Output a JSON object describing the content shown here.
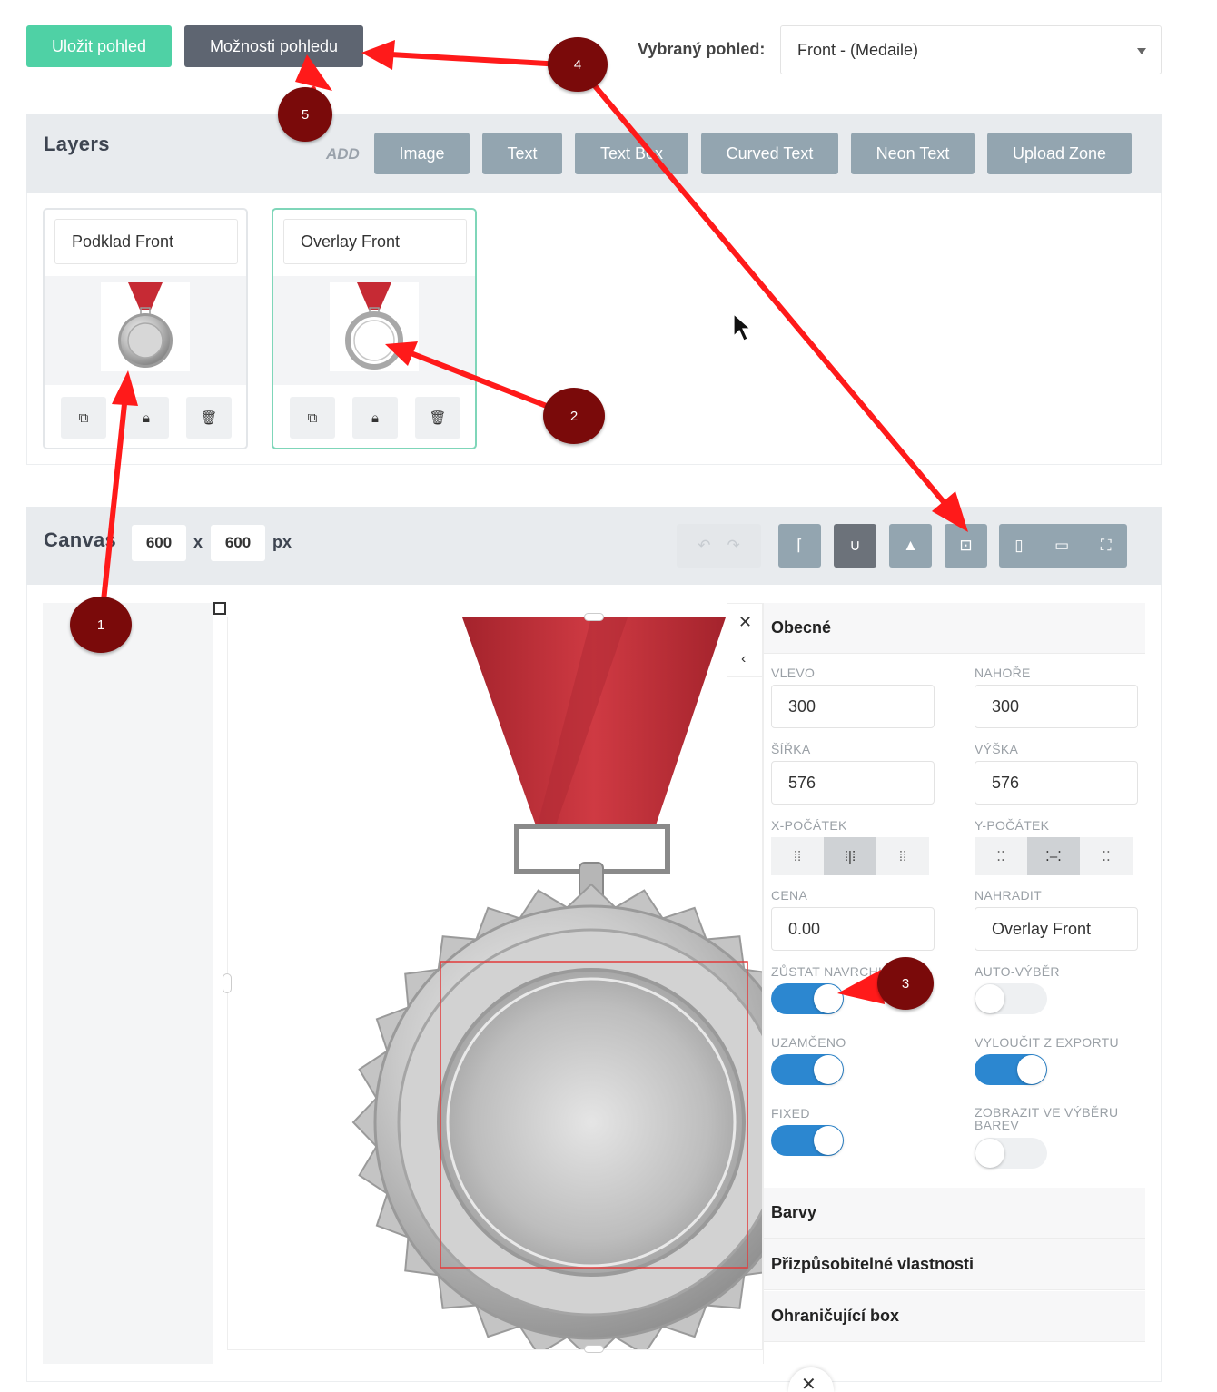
{
  "toolbar": {
    "save_label": "Uložit pohled",
    "options_label": "Možnosti pohledu",
    "selected_view_label": "Vybraný pohled:",
    "selected_view_value": "Front - (Medaile)"
  },
  "layers": {
    "title": "Layers",
    "add_label": "ADD",
    "add_buttons": [
      "Image",
      "Text",
      "Text Box",
      "Curved Text",
      "Neon Text",
      "Upload Zone"
    ],
    "items": [
      {
        "name": "Podklad Front",
        "active": false
      },
      {
        "name": "Overlay Front",
        "active": true
      }
    ]
  },
  "canvas": {
    "title": "Canvas",
    "width": "600",
    "height": "600",
    "separator": "x",
    "unit": "px"
  },
  "props": {
    "general_title": "Obecné",
    "left_label": "VLEVO",
    "left_value": "300",
    "top_label": "NAHOŘE",
    "top_value": "300",
    "width_label": "ŠÍŘKA",
    "width_value": "576",
    "height_label": "VÝŠKA",
    "height_value": "576",
    "xorigin_label": "X-POČÁTEK",
    "yorigin_label": "Y-POČÁTEK",
    "price_label": "CENA",
    "price_value": "0.00",
    "replace_label": "NAHRADIT",
    "replace_value": "Overlay Front",
    "stay_top_label": "ZŮSTAT NAVRCHU",
    "stay_top_on": true,
    "auto_select_label": "AUTO-VÝBĚR",
    "auto_select_on": false,
    "locked_label": "UZAMČENO",
    "locked_on": true,
    "exclude_label": "VYLOUČIT Z EXPORTU",
    "exclude_on": true,
    "fixed_label": "FIXED",
    "fixed_on": true,
    "color_sel_label": "ZOBRAZIT VE VÝBĚRU BAREV",
    "color_sel_on": false,
    "sections": [
      "Barvy",
      "Přizpůsobitelné vlastnosti",
      "Ohraničující box"
    ]
  },
  "annotations": [
    "1",
    "2",
    "3",
    "4",
    "5"
  ],
  "colors": {
    "save": "#4fd1a5",
    "options": "#5e6571",
    "add_button": "#93a5b0",
    "toggle_on": "#2c87d0",
    "marker": "#7a0a0a",
    "arrow": "#ff1a1a",
    "ribbon": "#c62a34"
  }
}
